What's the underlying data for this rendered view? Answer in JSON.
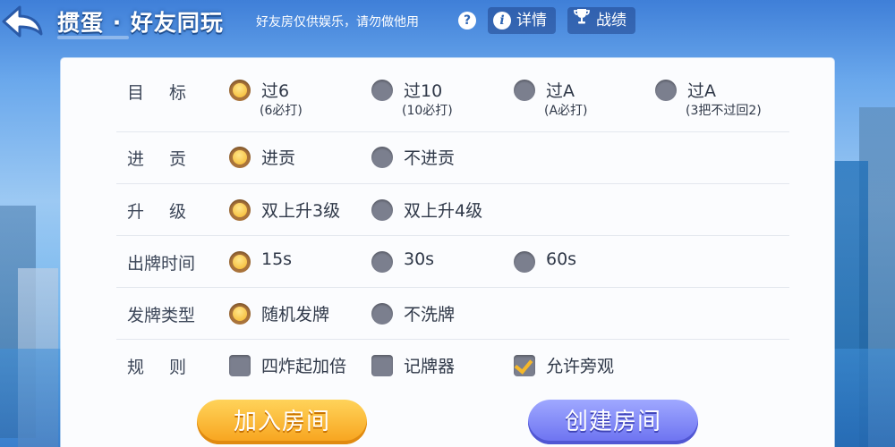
{
  "header": {
    "title": "掼蛋 · 好友同玩",
    "notice": "好友房仅供娱乐，请勿做他用",
    "help_icon_label": "?",
    "details_label": "详情",
    "record_label": "战绩",
    "info_icon_label": "i"
  },
  "settings": {
    "target": {
      "label": "目标",
      "options": [
        {
          "label": "过6",
          "sub": "(6必打)",
          "selected": true
        },
        {
          "label": "过10",
          "sub": "(10必打)",
          "selected": false
        },
        {
          "label": "过A",
          "sub": "(A必打)",
          "selected": false
        },
        {
          "label": "过A",
          "sub": "(3把不过回2)",
          "selected": false
        }
      ]
    },
    "tribute": {
      "label": "进贡",
      "options": [
        {
          "label": "进贡",
          "selected": true
        },
        {
          "label": "不进贡",
          "selected": false
        }
      ]
    },
    "upgrade": {
      "label": "升级",
      "options": [
        {
          "label": "双上升3级",
          "selected": true
        },
        {
          "label": "双上升4级",
          "selected": false
        }
      ]
    },
    "play_time": {
      "label": "出牌时间",
      "options": [
        {
          "label": "15s",
          "selected": true
        },
        {
          "label": "30s",
          "selected": false
        },
        {
          "label": "60s",
          "selected": false
        }
      ]
    },
    "deal_type": {
      "label": "发牌类型",
      "options": [
        {
          "label": "随机发牌",
          "selected": true
        },
        {
          "label": "不洗牌",
          "selected": false
        }
      ]
    },
    "rules": {
      "label": "规则",
      "options": [
        {
          "label": "四炸起加倍",
          "checked": false
        },
        {
          "label": "记牌器",
          "checked": false
        },
        {
          "label": "允许旁观",
          "checked": true
        }
      ]
    }
  },
  "actions": {
    "join_label": "加入房间",
    "create_label": "创建房间"
  },
  "colors": {
    "accent_gold": "#f4b52a",
    "radio_off": "#7b7f8e",
    "join_button": "#f7a21c",
    "create_button": "#6a70f0"
  }
}
